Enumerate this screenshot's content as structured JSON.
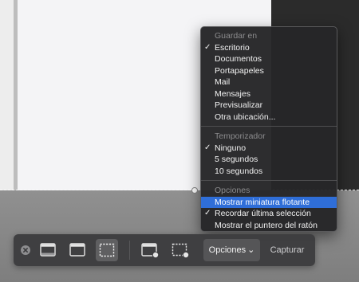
{
  "menu": {
    "sections": [
      {
        "header": "Guardar en",
        "items": [
          {
            "label": "Escritorio",
            "checked": true
          },
          {
            "label": "Documentos",
            "checked": false
          },
          {
            "label": "Portapapeles",
            "checked": false
          },
          {
            "label": "Mail",
            "checked": false
          },
          {
            "label": "Mensajes",
            "checked": false
          },
          {
            "label": "Previsualizar",
            "checked": false
          },
          {
            "label": "Otra ubicación...",
            "checked": false
          }
        ]
      },
      {
        "header": "Temporizador",
        "items": [
          {
            "label": "Ninguno",
            "checked": true
          },
          {
            "label": "5 segundos",
            "checked": false
          },
          {
            "label": "10 segundos",
            "checked": false
          }
        ]
      },
      {
        "header": "Opciones",
        "items": [
          {
            "label": "Mostrar miniatura flotante",
            "checked": false,
            "highlighted": true
          },
          {
            "label": "Recordar última selección",
            "checked": true
          },
          {
            "label": "Mostrar el puntero del ratón",
            "checked": false
          }
        ]
      }
    ],
    "check_glyph": "✓"
  },
  "toolbar": {
    "options_label": "Opciones",
    "options_chevron": "⌄",
    "capture_label": "Capturar",
    "icons": [
      "close-icon",
      "capture-screen-icon",
      "capture-window-icon",
      "capture-selection-icon",
      "record-screen-icon",
      "record-selection-icon"
    ]
  },
  "colors": {
    "highlight": "#2f6ed8",
    "menu_bg": "#262628",
    "toolbar_bg": "#3c3c3e"
  }
}
